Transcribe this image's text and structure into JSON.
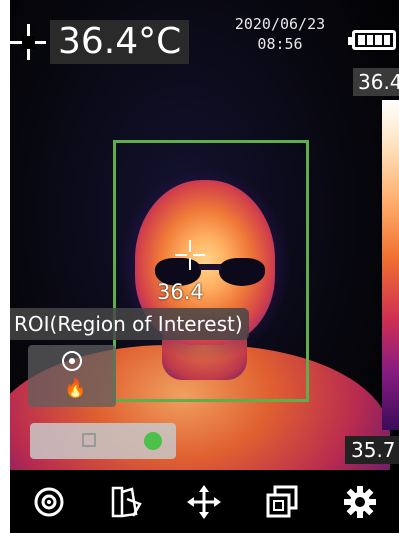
{
  "header": {
    "spot_temperature": "36.4°C",
    "date": "2020/06/23",
    "time": "08:56"
  },
  "color_scale": {
    "max_label": "36.4",
    "min_label": "35.7"
  },
  "roi": {
    "label": "ROI(Region of Interest)",
    "center_temperature": "36.4",
    "box_color": "#5fae4a"
  },
  "icons": {
    "side_panel": [
      "target-icon",
      "flame-icon"
    ],
    "toggle": [
      "square-icon",
      "status-dot"
    ],
    "toolbar": [
      "target-icon",
      "palette-icon",
      "move-icon",
      "gallery-icon",
      "gear-icon"
    ]
  },
  "colors": {
    "status_dot": "#4cc04a"
  }
}
